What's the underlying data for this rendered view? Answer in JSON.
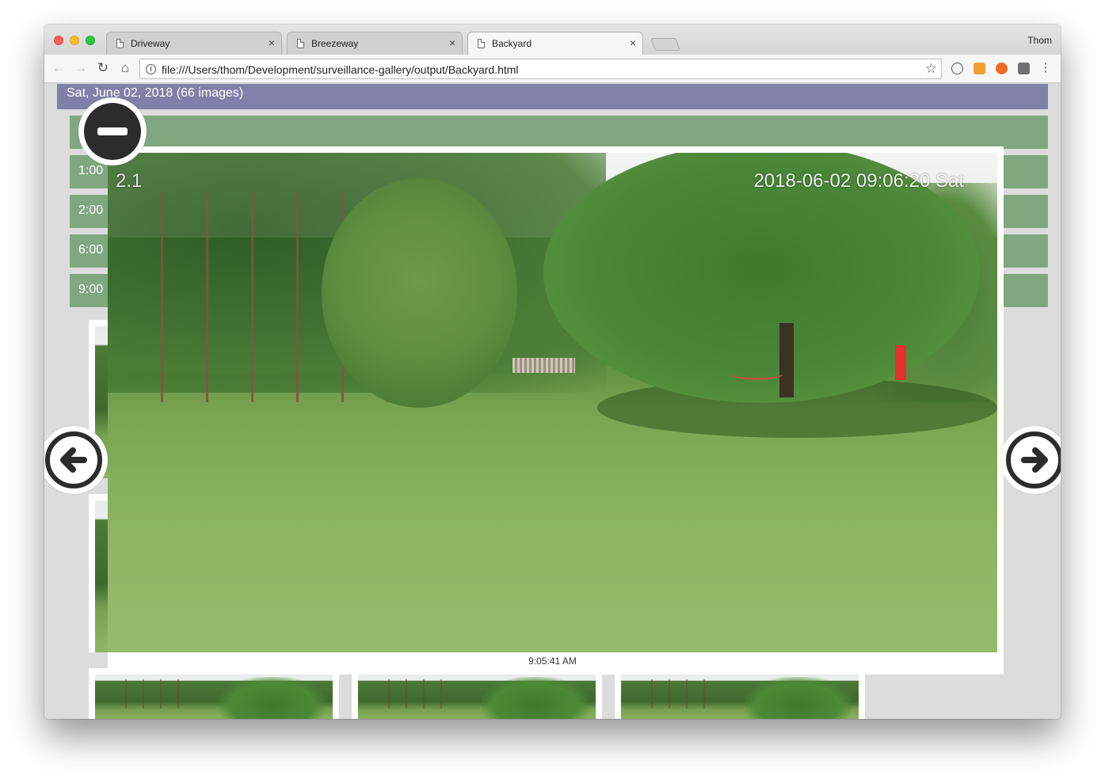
{
  "browser": {
    "tabs": [
      {
        "label": "Driveway",
        "close": "×"
      },
      {
        "label": "Breezeway",
        "close": "×"
      },
      {
        "label": "Backyard",
        "close": "×"
      }
    ],
    "profile_name": "Thom",
    "url": "file:///Users/thom/Development/surveillance-gallery/output/Backyard.html",
    "info_glyph": "i",
    "star_glyph": "☆",
    "nav": {
      "back": "←",
      "forward": "→",
      "reload": "↻",
      "home": "⌂"
    },
    "extension_colors": [
      "#f0a030",
      "#f06a2a",
      "#707070"
    ]
  },
  "gallery": {
    "day_header": "Sat, June 02, 2018 (66 images)",
    "hour_rows": [
      "",
      "1:00",
      "2:00",
      "6:00",
      "9:00"
    ]
  },
  "lightbox": {
    "camera_label": "2.1",
    "timestamp": "2018-06-02 09:06:20 Sat",
    "caption": "9:05:41 AM",
    "icons": [
      "minus-icon",
      "arrow-left-icon",
      "arrow-right-icon"
    ]
  },
  "colors": {
    "day_header_bg": "#8080a8",
    "hour_row_bg": "#80a880",
    "page_bg": "#dcdcdc"
  }
}
